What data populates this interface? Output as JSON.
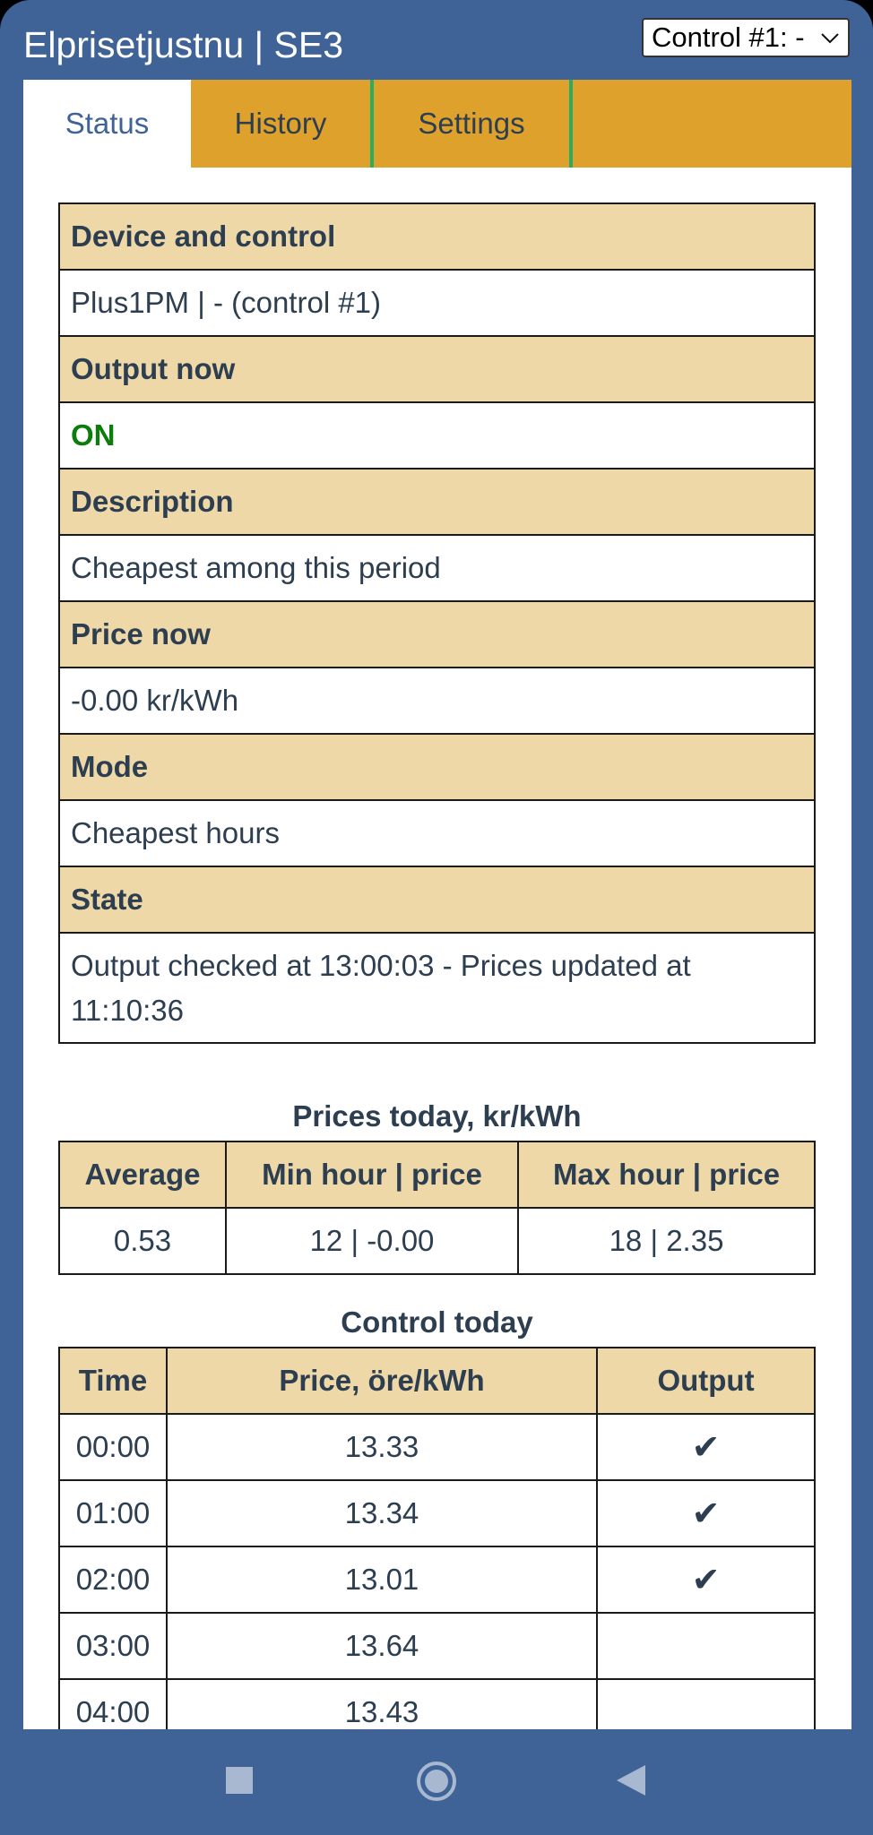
{
  "app": {
    "title": "Elprisetjustnu | SE3",
    "control_select": {
      "value": "Control #1: -"
    }
  },
  "tabs": [
    {
      "label": "Status",
      "active": true
    },
    {
      "label": "History",
      "active": false
    },
    {
      "label": "Settings",
      "active": false
    }
  ],
  "status": {
    "rows": [
      {
        "header": "Device and control",
        "value": "Plus1PM | - (control #1)"
      },
      {
        "header": "Output now",
        "value": "ON"
      },
      {
        "header": "Description",
        "value": "Cheapest among this period"
      },
      {
        "header": "Price now",
        "value": "-0.00 kr/kWh"
      },
      {
        "header": "Mode",
        "value": "Cheapest hours"
      },
      {
        "header": "State",
        "value": "Output checked at 13:00:03 - Prices updated at 11:10:36"
      }
    ]
  },
  "prices_today": {
    "caption": "Prices today, kr/kWh",
    "columns": [
      "Average",
      "Min hour | price",
      "Max hour | price"
    ],
    "values": [
      "0.53",
      "12 | -0.00",
      "18 | 2.35"
    ]
  },
  "control_today": {
    "caption": "Control today",
    "columns": [
      "Time",
      "Price, öre/kWh",
      "Output"
    ],
    "rows": [
      {
        "time": "00:00",
        "price": "13.33",
        "output": "✔"
      },
      {
        "time": "01:00",
        "price": "13.34",
        "output": "✔"
      },
      {
        "time": "02:00",
        "price": "13.01",
        "output": "✔"
      },
      {
        "time": "03:00",
        "price": "13.64",
        "output": ""
      },
      {
        "time": "04:00",
        "price": "13.43",
        "output": ""
      }
    ]
  },
  "colors": {
    "frame": "#3f6397",
    "tab_bar": "#dea12c",
    "header_cell": "#eed8a8",
    "on_text": "#0a7d0a"
  },
  "navigation": {
    "icons": [
      "square-recents-icon",
      "circle-home-icon",
      "triangle-back-icon"
    ]
  }
}
